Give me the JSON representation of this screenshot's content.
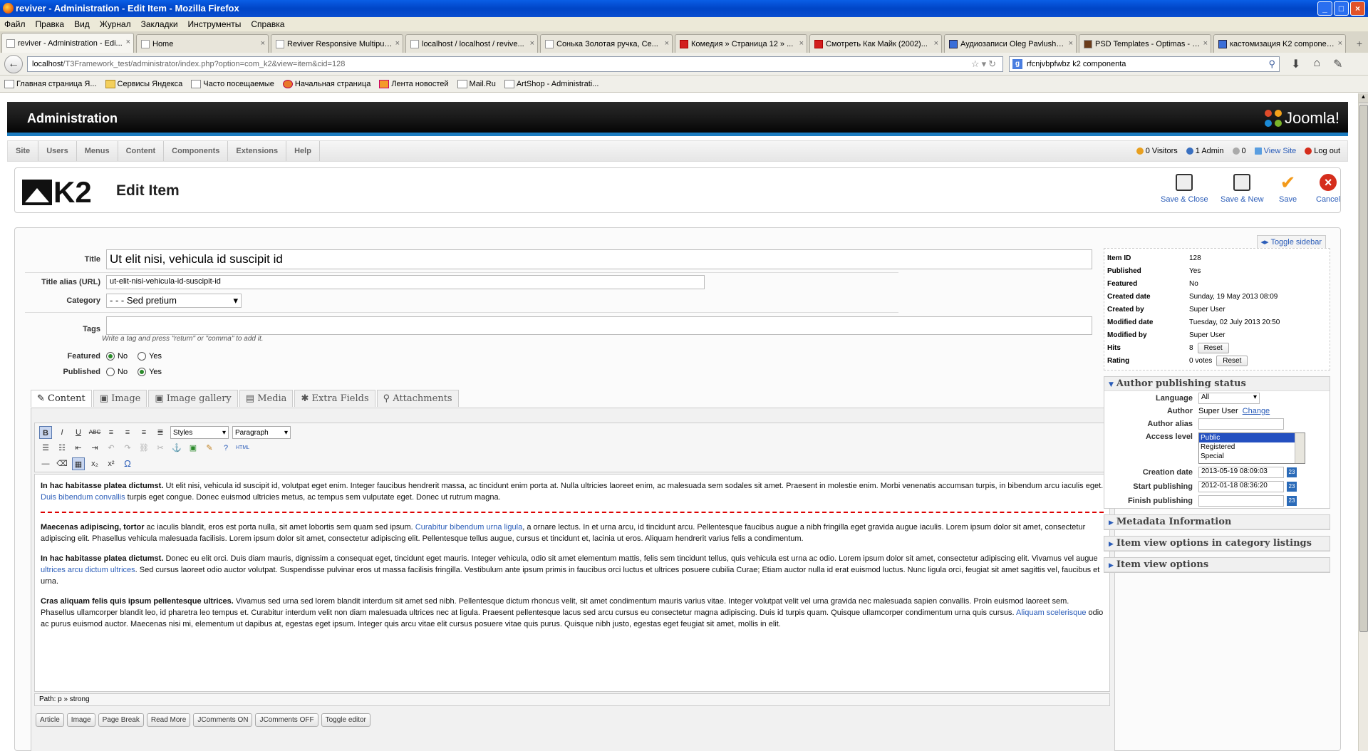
{
  "window": {
    "title": "reviver - Administration - Edit Item - Mozilla Firefox"
  },
  "menubar": [
    "Файл",
    "Правка",
    "Вид",
    "Журнал",
    "Закладки",
    "Инструменты",
    "Справка"
  ],
  "tabs": [
    {
      "label": "reviver - Administration - Edi...",
      "icon": "joomla-icon",
      "active": true
    },
    {
      "label": "Home",
      "icon": "page-icon"
    },
    {
      "label": "Reviver Responsive Multipur...",
      "icon": "page-icon"
    },
    {
      "label": "localhost / localhost / revive...",
      "icon": "page-icon"
    },
    {
      "label": "Сонька Золотая ручка, Се...",
      "icon": "page-icon"
    },
    {
      "label": "Комедия » Страница 12 » ...",
      "icon": "red-icon"
    },
    {
      "label": "Смотреть Как Майк (2002)...",
      "icon": "red-icon"
    },
    {
      "label": "Аудиозаписи Oleg Pavlushe...",
      "icon": "blue-icon"
    },
    {
      "label": "PSD Templates - Optimas - P...",
      "icon": "psd-icon"
    },
    {
      "label": "кастомизация K2 componen...",
      "icon": "google-icon"
    }
  ],
  "url": {
    "host": "localhost",
    "path": "/T3Framework_test/administrator/index.php?option=com_k2&view=item&cid=128"
  },
  "search": {
    "value": "rfcnjvbpfwbz k2 componenta"
  },
  "bookmarks": [
    "Главная страница Я...",
    "Сервисы Яндекса",
    "Часто посещаемые",
    "Начальная страница",
    "Лента новостей",
    "Mail.Ru",
    "ArtShop - Administrati..."
  ],
  "admin": {
    "title": "Administration",
    "brand": "Joomla!"
  },
  "topnav": [
    "Site",
    "Users",
    "Menus",
    "Content",
    "Components",
    "Extensions",
    "Help"
  ],
  "status": {
    "visitors": "0 Visitors",
    "admin": "1 Admin",
    "messages": "0",
    "view_site": "View Site",
    "logout": "Log out"
  },
  "toolbar": {
    "k2": "K2",
    "title": "Edit Item",
    "save_close": "Save & Close",
    "save_new": "Save & New",
    "save": "Save",
    "cancel": "Cancel"
  },
  "toggle_sidebar": "Toggle sidebar",
  "form": {
    "title_label": "Title",
    "title_value": "Ut elit nisi, vehicula id suscipit id",
    "alias_label": "Title alias (URL)",
    "alias_value": "ut-elit-nisi-vehicula-id-suscipit-id",
    "category_label": "Category",
    "category_value": "- - - Sed pretium",
    "tags_label": "Tags",
    "tags_hint": "Write a tag and press \"return\" or \"comma\" to add it.",
    "featured_label": "Featured",
    "published_label": "Published",
    "no": "No",
    "yes": "Yes",
    "featured": "No",
    "published": "Yes"
  },
  "content_tabs": [
    "Content",
    "Image",
    "Image gallery",
    "Media",
    "Extra Fields",
    "Attachments"
  ],
  "editor": {
    "styles": "Styles",
    "paragraph": "Paragraph",
    "path": "Path: p » strong",
    "paragraphs": [
      {
        "strong": "In hac habitasse platea dictumst.",
        "text": " Ut elit nisi, vehicula id suscipit id, volutpat eget enim. Integer faucibus hendrerit massa, ac tincidunt enim porta at. Nulla ultricies laoreet enim, ac malesuada sem sodales sit amet. Praesent in molestie enim. Morbi venenatis accumsan turpis, in bibendum arcu iaculis eget. ",
        "link": "Duis bibendum convallis",
        "after": " turpis eget congue. Donec euismod ultricies metus, ac tempus sem vulputate eget. Donec ut rutrum magna."
      },
      {
        "strong": "Maecenas adipiscing, tortor",
        "text": " ac iaculis blandit, eros est porta nulla, sit amet lobortis sem quam sed ipsum. ",
        "link": "Curabitur bibendum urna ligula",
        "after": ", a ornare lectus. In et urna arcu, id tincidunt arcu. Pellentesque faucibus augue a nibh fringilla eget gravida augue iaculis. Lorem ipsum dolor sit amet, consectetur adipiscing elit. Phasellus vehicula malesuada facilisis. Lorem ipsum dolor sit amet, consectetur adipiscing elit. Pellentesque tellus augue, cursus et tincidunt et, lacinia ut eros. Aliquam hendrerit varius felis a condimentum."
      },
      {
        "strong": "In hac habitasse platea dictumst.",
        "text": " Donec eu elit orci. Duis diam mauris, dignissim a consequat eget, tincidunt eget mauris. Integer vehicula, odio sit amet elementum mattis, felis sem tincidunt tellus, quis vehicula est urna ac odio. Lorem ipsum dolor sit amet, consectetur adipiscing elit. Vivamus vel augue ",
        "link": "ultrices arcu dictum ultrices",
        "after": ". Sed cursus laoreet odio auctor volutpat. Suspendisse pulvinar eros ut massa facilisis fringilla. Vestibulum ante ipsum primis in faucibus orci luctus et ultrices posuere cubilia Curae; Etiam auctor nulla id erat euismod luctus. Nunc ligula orci, feugiat sit amet sagittis vel, faucibus et urna."
      },
      {
        "strong": "Cras aliquam felis quis ipsum pellentesque ultrices.",
        "text": " Vivamus sed urna sed lorem blandit interdum sit amet sed nibh. Pellentesque dictum rhoncus velit, sit amet condimentum mauris varius vitae. Integer volutpat velit vel urna gravida nec malesuada sapien convallis. Proin euismod laoreet sem. Phasellus ullamcorper blandit leo, id pharetra leo tempus et. Curabitur interdum velit non diam malesuada ultrices nec at ligula. Praesent pellentesque lacus sed arcu cursus eu consectetur magna adipiscing. Duis id turpis quam. Quisque ullamcorper condimentum urna quis cursus. ",
        "link": "Aliquam scelerisque",
        "after": " odio ac purus euismod auctor. Maecenas nisi mi, elementum ut dapibus at, egestas eget ipsum. Integer quis arcu vitae elit cursus posuere vitae quis purus. Quisque nibh justo, egestas eget feugiat sit amet, mollis in elit."
      }
    ],
    "buttons": [
      "Article",
      "Image",
      "Page Break",
      "Read More",
      "JComments ON",
      "JComments OFF",
      "Toggle editor"
    ]
  },
  "info": [
    {
      "k": "Item ID",
      "v": "128"
    },
    {
      "k": "Published",
      "v": "Yes"
    },
    {
      "k": "Featured",
      "v": "No"
    },
    {
      "k": "Created date",
      "v": "Sunday, 19 May 2013 08:09"
    },
    {
      "k": "Created by",
      "v": "Super User"
    },
    {
      "k": "Modified date",
      "v": "Tuesday, 02 July 2013 20:50"
    },
    {
      "k": "Modified by",
      "v": "Super User"
    },
    {
      "k": "Hits",
      "v": "8"
    },
    {
      "k": "Rating",
      "v": "0 votes"
    }
  ],
  "reset": "Reset",
  "author_panel": {
    "title": "Author publishing status",
    "language_label": "Language",
    "language_value": "All",
    "author_label": "Author",
    "author_value": "Super User",
    "change": "Change",
    "alias_label": "Author alias",
    "access_label": "Access level",
    "access_options": [
      "Public",
      "Registered",
      "Special"
    ],
    "creation_label": "Creation date",
    "creation_value": "2013-05-19 08:09:03",
    "start_label": "Start publishing",
    "start_value": "2012-01-18 08:36:20",
    "finish_label": "Finish publishing"
  },
  "panels": [
    "Metadata Information",
    "Item view options in category listings",
    "Item view options"
  ]
}
